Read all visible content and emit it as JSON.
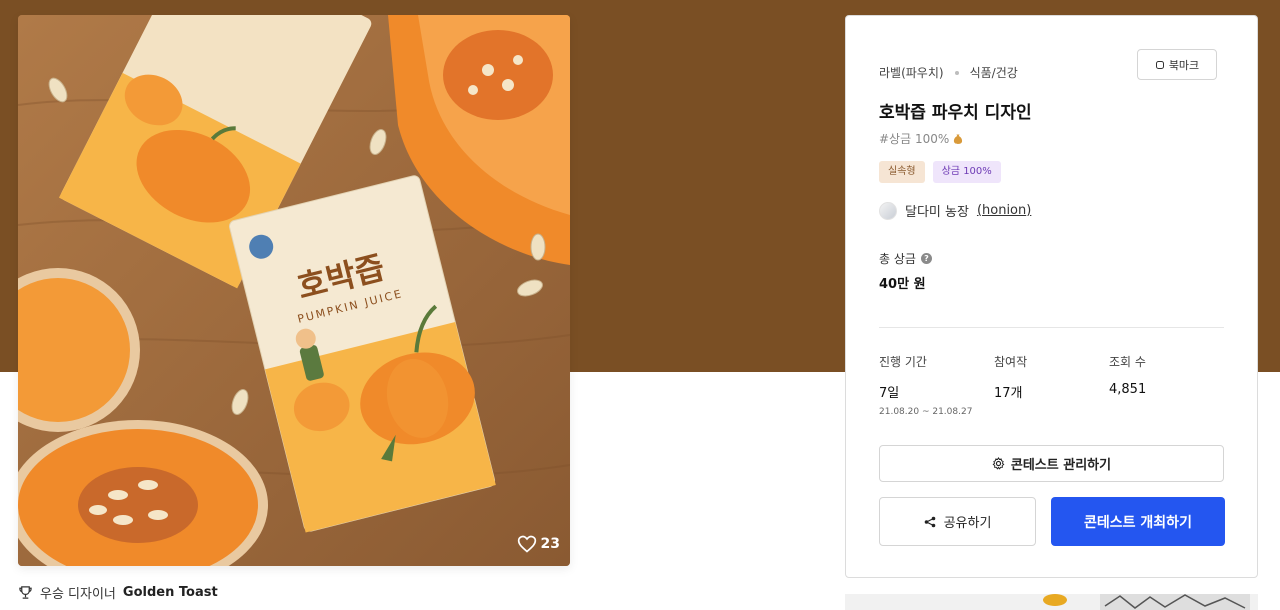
{
  "colors": {
    "band": "#7a4f24",
    "primary_button": "#2456f0",
    "badge_practical_bg": "#f6e5d4",
    "badge_prize_bg": "#efe5fb"
  },
  "image": {
    "alt": "호박즙 파우치",
    "likes": "23",
    "like_icon": "heart-icon"
  },
  "winner": {
    "icon": "trophy-icon",
    "label": "우승 디자이너",
    "name": "Golden Toast"
  },
  "contest": {
    "category_main": "라벨(파우치)",
    "category_sub": "식품/건강",
    "bookmark_label": "북마크",
    "bookmark_icon": "bookmark-icon",
    "title": "호박즙 파우치 디자인",
    "prize_tag": "#상금 100%",
    "prize_tag_icon": "money-bag-icon",
    "badges": [
      "실속형",
      "상금 100%"
    ],
    "host_name": "달다미 농장",
    "host_handle": "honion",
    "total_prize_label": "총 상금",
    "total_prize_value": "40만 원",
    "stats": {
      "period_label": "진행 기간",
      "period_value": "7일",
      "period_dates": "21.08.20 ~ 21.08.27",
      "entries_label": "참여작",
      "entries_value": "17개",
      "views_label": "조회 수",
      "views_value": "4,851"
    },
    "manage_label": "콘테스트 관리하기",
    "share_label": "공유하기",
    "host_contest_label": "콘테스트 개최하기"
  }
}
